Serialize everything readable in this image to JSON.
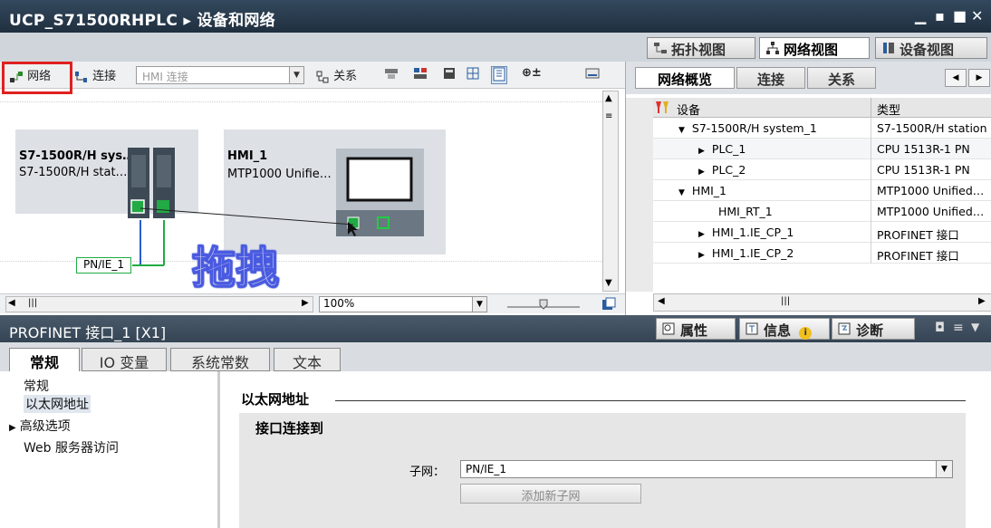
{
  "window": {
    "title": "UCP_S71500RHPLC ▸ 设备和网络",
    "controls": [
      "_",
      "▪",
      "■",
      "✕"
    ]
  },
  "view_tabs": [
    {
      "label": "拓扑视图",
      "icon": "topology-icon",
      "active": false
    },
    {
      "label": "网络视图",
      "icon": "network-view-icon",
      "active": true
    },
    {
      "label": "设备视图",
      "icon": "device-view-icon",
      "active": false
    }
  ],
  "toolbar": {
    "network_label": "网络",
    "connect_label": "连接",
    "hmi_select_placeholder": "HMI 连接",
    "relation_label": "关系",
    "zoom_label": "⊕±"
  },
  "canvas": {
    "station1": {
      "name": "S7-1500R/H sys…",
      "type": "S7-1500R/H stat…"
    },
    "station2": {
      "name": "HMI_1",
      "type": "MTP1000 Unifie…"
    },
    "subnet_label": "PN/IE_1",
    "drag_annotation": "拖拽",
    "zoom_value": "100%"
  },
  "overview": {
    "tabs": [
      {
        "label": "网络概览",
        "active": true
      },
      {
        "label": "连接",
        "active": false
      },
      {
        "label": "关系",
        "active": false
      }
    ],
    "col_device": "设备",
    "col_type": "类型",
    "rows": [
      {
        "device": "S7-1500R/H system_1",
        "type": "S7-1500R/H station",
        "level": 1,
        "arrow": "▼"
      },
      {
        "device": "PLC_1",
        "type": "CPU 1513R-1 PN",
        "level": 2,
        "arrow": "▶"
      },
      {
        "device": "PLC_2",
        "type": "CPU 1513R-1 PN",
        "level": 2,
        "arrow": "▶"
      },
      {
        "device": "HMI_1",
        "type": "MTP1000 Unified…",
        "level": 1,
        "arrow": "▼"
      },
      {
        "device": "HMI_RT_1",
        "type": "MTP1000 Unified…",
        "level": 2,
        "arrow": ""
      },
      {
        "device": "HMI_1.IE_CP_1",
        "type": "PROFINET 接口",
        "level": 2,
        "arrow": "▶"
      },
      {
        "device": "HMI_1.IE_CP_2",
        "type": "PROFINET 接口",
        "level": 2,
        "arrow": "▶"
      }
    ]
  },
  "inspector": {
    "title": "PROFINET 接口_1 [X1]",
    "tabs": [
      {
        "label": "属性",
        "icon": "properties-icon"
      },
      {
        "label": "信息",
        "icon": "info-icon"
      },
      {
        "label": "诊断",
        "icon": "diagnostics-icon"
      }
    ],
    "subtabs": [
      {
        "label": "常规",
        "active": true
      },
      {
        "label": "IO 变量",
        "active": false
      },
      {
        "label": "系统常数",
        "active": false
      },
      {
        "label": "文本",
        "active": false
      }
    ],
    "nav": [
      {
        "label": "常规",
        "arrow": ""
      },
      {
        "label": "以太网地址",
        "arrow": "",
        "selected": true
      },
      {
        "label": "高级选项",
        "arrow": "▶"
      },
      {
        "label": "Web 服务器访问",
        "arrow": ""
      }
    ],
    "section_title": "以太网地址",
    "group_title": "接口连接到",
    "subnet_field_label": "子网：",
    "subnet_value": "PN/IE_1",
    "add_subnet_button": "添加新子网"
  }
}
